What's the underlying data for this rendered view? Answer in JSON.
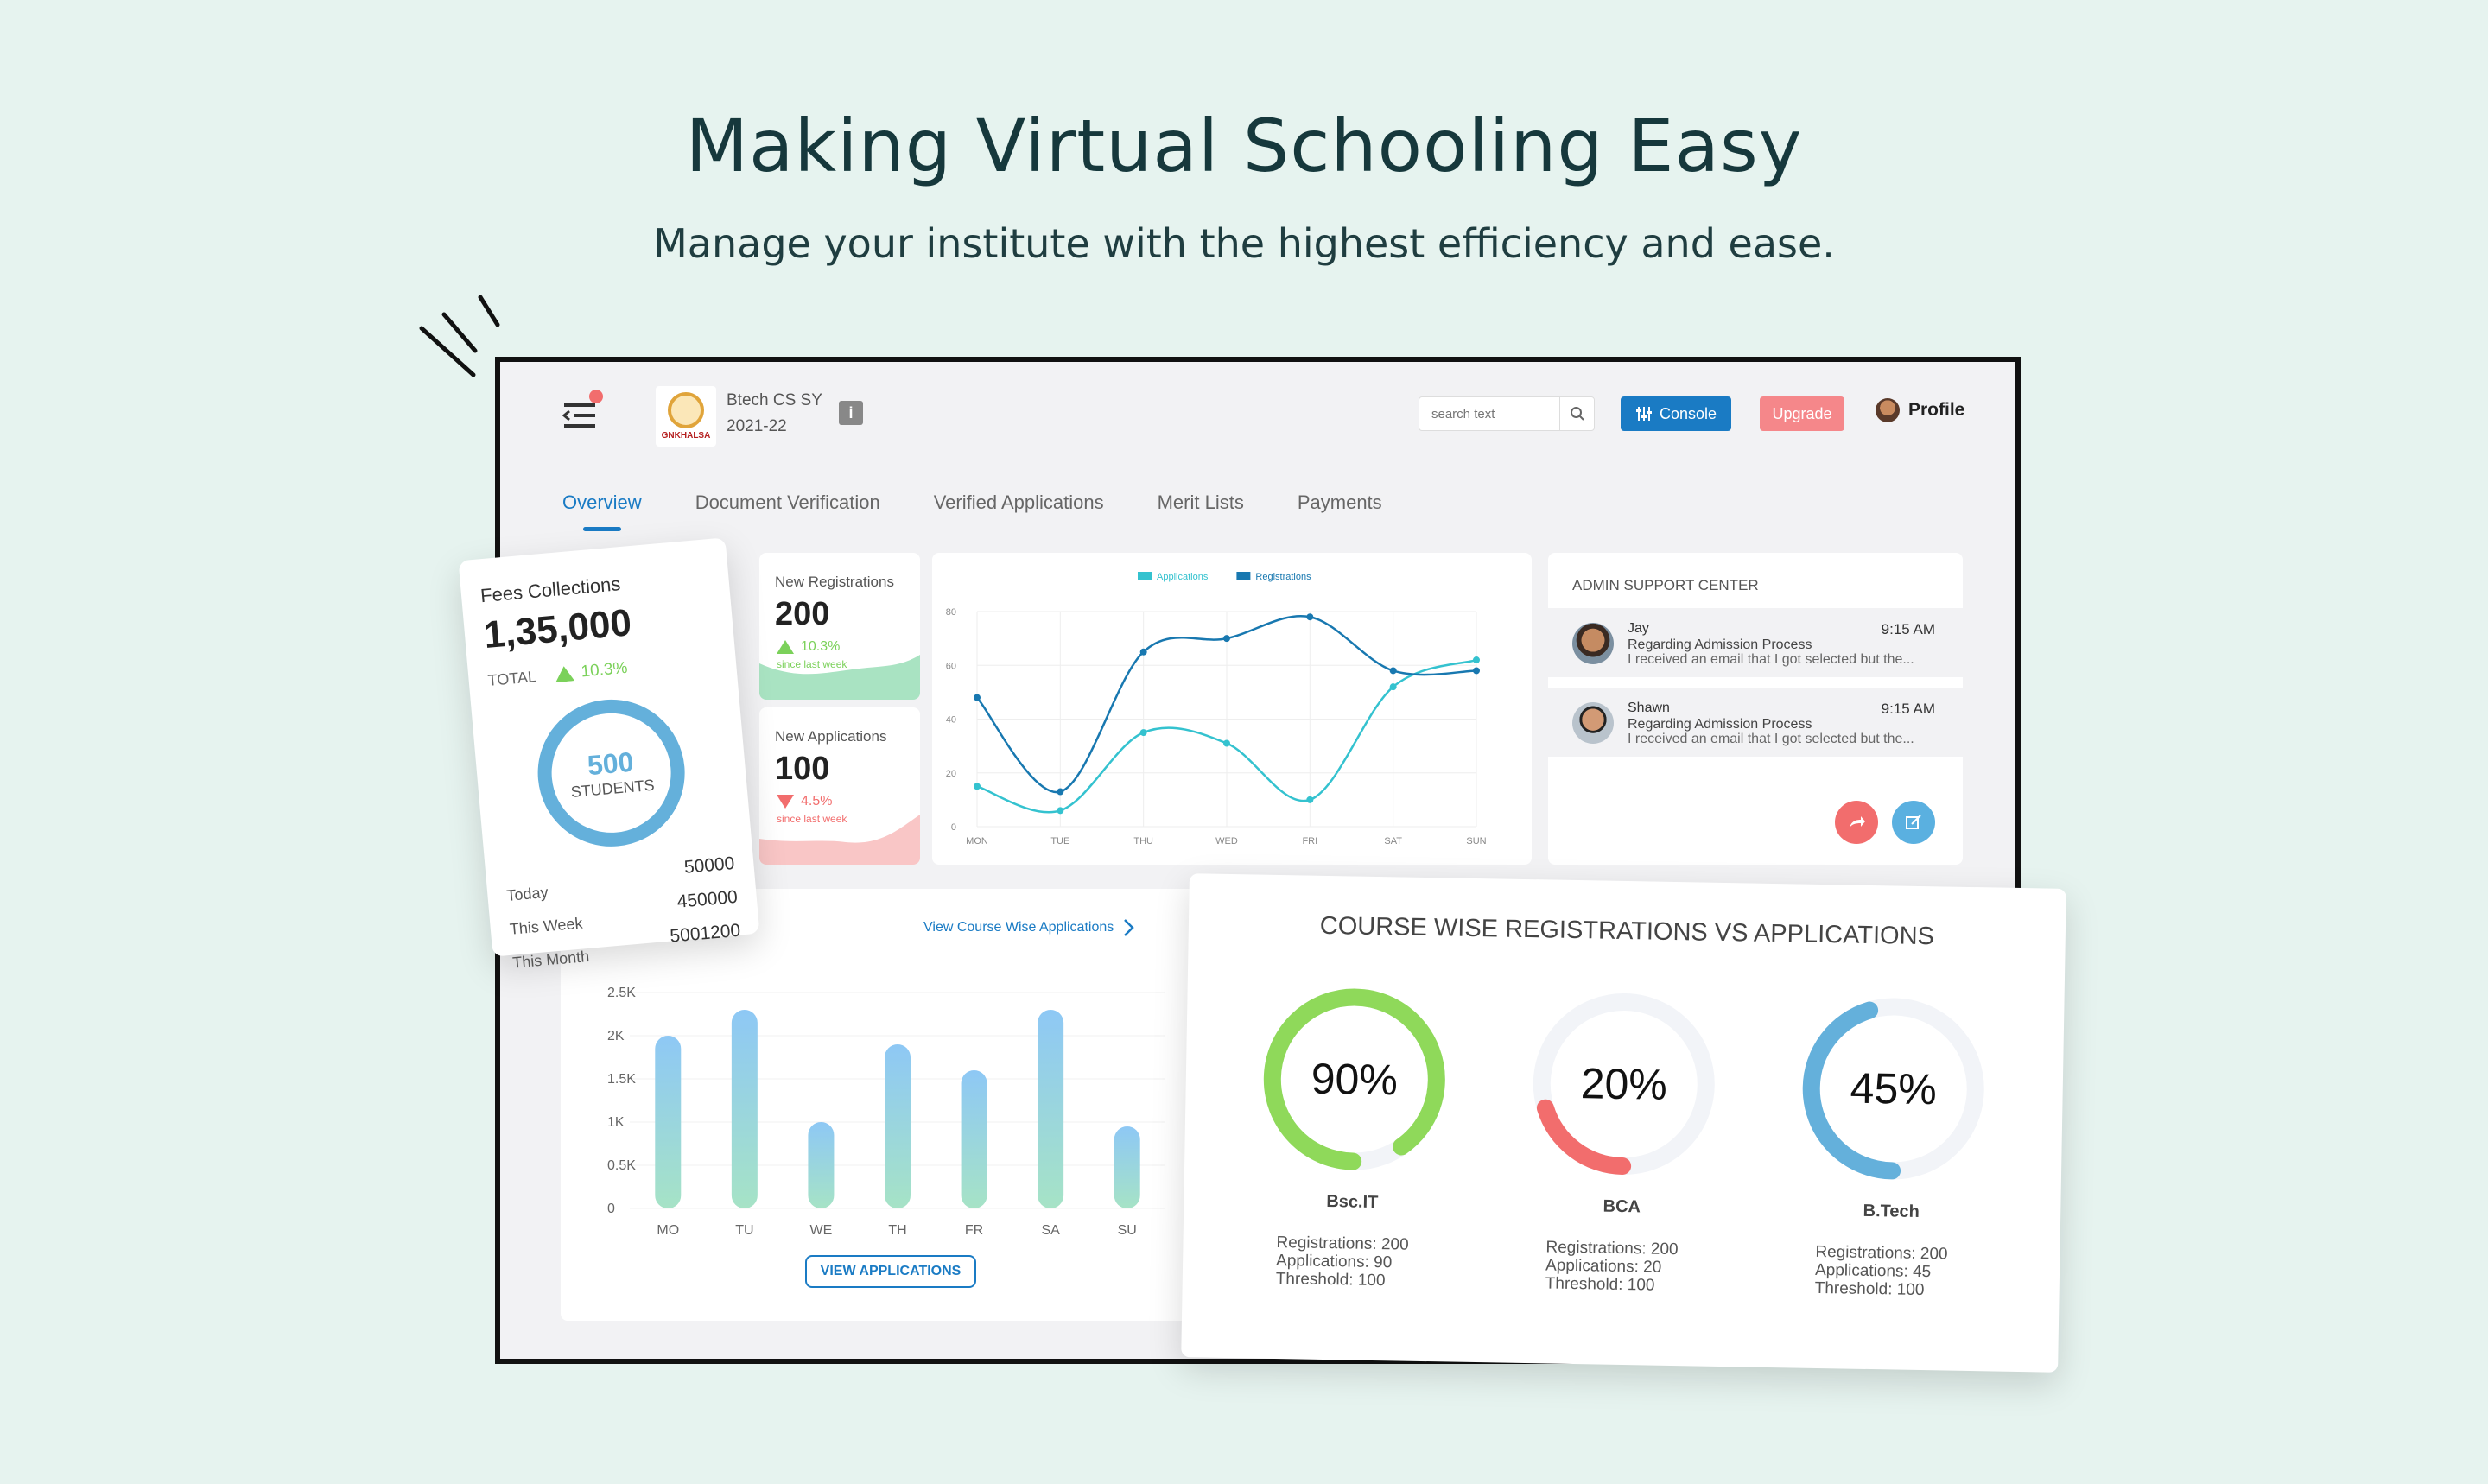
{
  "hero": {
    "title": "Making Virtual Schooling Easy",
    "subtitle": "Manage your institute with the highest efficiency and ease."
  },
  "header": {
    "logo_text": "GNKHALSA",
    "batch_name": "Btech CS SY",
    "batch_year": "2021-22",
    "info_label": "i",
    "search_placeholder": "search text",
    "console_label": "Console",
    "upgrade_label": "Upgrade",
    "profile_label": "Profile"
  },
  "tabs": [
    {
      "label": "Overview",
      "active": true
    },
    {
      "label": "Document Verification",
      "active": false
    },
    {
      "label": "Verified Applications",
      "active": false
    },
    {
      "label": "Merit Lists",
      "active": false
    },
    {
      "label": "Payments",
      "active": false
    }
  ],
  "fees": {
    "title": "Fees Collections",
    "value": "1,35,000",
    "total_label": "TOTAL",
    "delta": "10.3%",
    "ring_value": "500",
    "ring_label": "STUDENTS",
    "rows": [
      {
        "label": "Today",
        "value": "50000"
      },
      {
        "label": "This Week",
        "value": "450000"
      },
      {
        "label": "This Month",
        "value": "5001200"
      }
    ]
  },
  "registrations": {
    "label": "New Registrations",
    "value": "200",
    "delta": "10.3%",
    "since": "since last week"
  },
  "applications": {
    "label": "New Applications",
    "value": "100",
    "delta": "4.5%",
    "since": "since last week"
  },
  "support": {
    "title": "ADMIN SUPPORT CENTER",
    "messages": [
      {
        "name": "Jay",
        "time": "9:15 AM",
        "subject": "Regarding Admission Process",
        "text": "I received an email that I got selected but the..."
      },
      {
        "name": "Shawn",
        "time": "9:15 AM",
        "subject": "Regarding Admission Process",
        "text": "I received an email that I got selected but the..."
      }
    ]
  },
  "bar_section": {
    "link_label": "View Course Wise Applications",
    "button_label": "VIEW APPLICATIONS"
  },
  "course": {
    "title": "COURSE WISE REGISTRATIONS VS APPLICATIONS",
    "items": [
      {
        "percent_label": "90%",
        "value": 0.9,
        "color": "#8fd95a",
        "name": "Bsc.IT",
        "registrations": "Registrations: 200",
        "applications": "Applications: 90",
        "threshold": "Threshold: 100"
      },
      {
        "percent_label": "20%",
        "value": 0.2,
        "color": "#f26d6d",
        "name": "BCA",
        "registrations": "Registrations: 200",
        "applications": "Applications: 20",
        "threshold": "Threshold: 100"
      },
      {
        "percent_label": "45%",
        "value": 0.45,
        "color": "#64b0db",
        "name": "B.Tech",
        "registrations": "Registrations: 200",
        "applications": "Applications: 45",
        "threshold": "Threshold: 100"
      }
    ]
  },
  "colors": {
    "primary": "#1a7bc4",
    "upgrade": "#f5878a",
    "green": "#7bd15a",
    "red": "#f26d6d",
    "teal": "#34c2cf",
    "navy": "#1878b0"
  },
  "chart_data": [
    {
      "type": "line",
      "x": [
        "MON",
        "TUE",
        "THU",
        "WED",
        "FRI",
        "SAT",
        "SUN"
      ],
      "ylim": [
        0,
        80
      ],
      "yticks": [
        0,
        20,
        40,
        60,
        80
      ],
      "series": [
        {
          "name": "Applications",
          "color": "#34c2cf",
          "values": [
            15,
            6,
            35,
            31,
            10,
            52,
            62
          ]
        },
        {
          "name": "Registrations",
          "color": "#1878b0",
          "values": [
            48,
            13,
            65,
            70,
            78,
            58,
            58
          ]
        }
      ]
    },
    {
      "type": "bar",
      "categories": [
        "MO",
        "TU",
        "WE",
        "TH",
        "FR",
        "SA",
        "SU"
      ],
      "values": [
        2000,
        2300,
        1000,
        1900,
        1600,
        2300,
        950
      ],
      "ylim": [
        0,
        2500
      ],
      "yticks": [
        "0",
        "0.5K",
        "1K",
        "1.5K",
        "2K",
        "2.5K"
      ]
    }
  ]
}
